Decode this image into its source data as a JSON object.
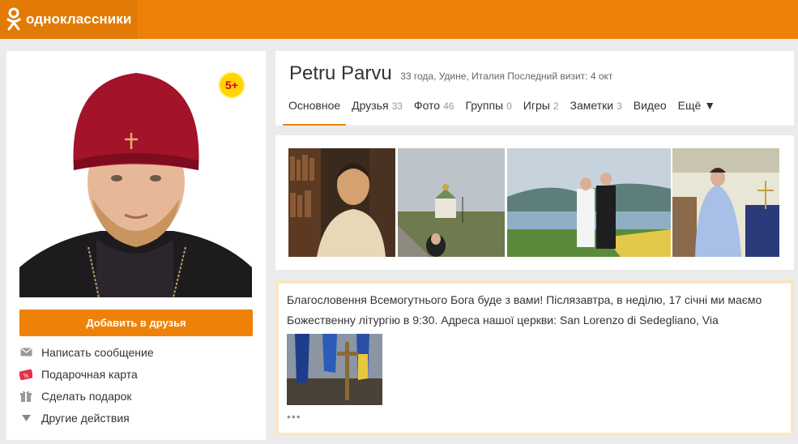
{
  "header": {
    "logo_text": "одноклассники",
    "logo_icon": "ok-logo-icon"
  },
  "profile": {
    "name": "Petru Parvu",
    "meta": "33 года, Удине, Италия Последний визит: 4 окт",
    "badge": "5+",
    "add_friend_label": "Добавить в друзья",
    "actions": [
      {
        "label": "Написать сообщение",
        "icon": "envelope-icon"
      },
      {
        "label": "Подарочная карта",
        "icon": "gift-card-icon"
      },
      {
        "label": "Сделать подарок",
        "icon": "gift-icon"
      },
      {
        "label": "Другие действия",
        "icon": "triangle-down-icon"
      }
    ]
  },
  "tabs": [
    {
      "label": "Основное",
      "count": ""
    },
    {
      "label": "Друзья",
      "count": "33"
    },
    {
      "label": "Фото",
      "count": "46"
    },
    {
      "label": "Группы",
      "count": "0"
    },
    {
      "label": "Игры",
      "count": "2"
    },
    {
      "label": "Заметки",
      "count": "3"
    },
    {
      "label": "Видео",
      "count": ""
    },
    {
      "label": "Ещё ▼",
      "count": ""
    }
  ],
  "post": {
    "text": "Благословення Всемогутнього Бога буде з вами! Післязавтра, в неділю, 17 січні ми маємо Божественну літургію в 9:30. Адреса нашої церкви: San Lorenzo di Sedegliano, Via",
    "more": "•••"
  },
  "colors": {
    "brand": "#ee8208",
    "badge": "#ffd600",
    "post_border": "#fbe6c4"
  }
}
